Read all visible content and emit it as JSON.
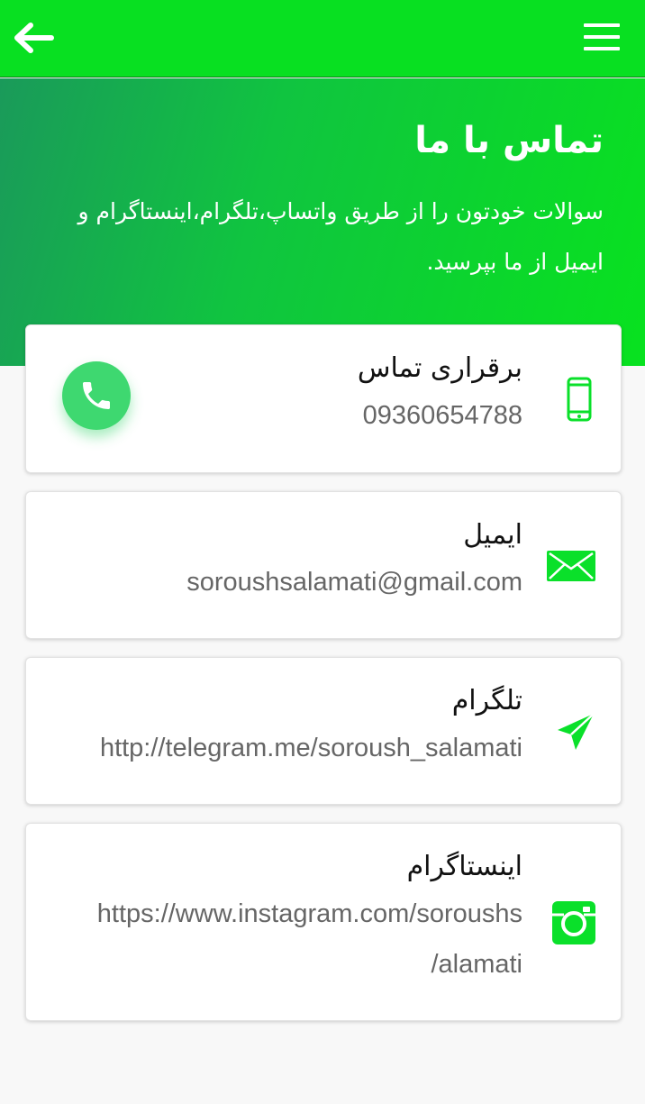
{
  "header": {
    "back_icon": "arrow-left-icon",
    "menu_icon": "hamburger-menu-icon",
    "bar_color": "#08e021"
  },
  "hero": {
    "title": "تماس با ما",
    "description": "سوالات خودتون را از طریق واتساپ،تلگرام،اینستاگرام و ایمیل از ما بپرسید."
  },
  "contacts": {
    "phone": {
      "title": "برقراری تماس",
      "value": "09360654788",
      "icon": "mobile-phone-icon",
      "action_icon": "call-icon"
    },
    "email": {
      "title": "ایمیل",
      "value": "soroushsalamati@gmail.com",
      "icon": "envelope-icon"
    },
    "telegram": {
      "title": "تلگرام",
      "value": "http://telegram.me/soroush_salamati",
      "icon": "paper-plane-icon"
    },
    "instagram": {
      "title": "اینستاگرام",
      "value_line1": "https://www.instagram.com/soroushs",
      "value_line2": "/alamati",
      "icon": "camera-icon"
    }
  },
  "colors": {
    "accent": "#0ae02a",
    "call_button": "#3ed870"
  }
}
